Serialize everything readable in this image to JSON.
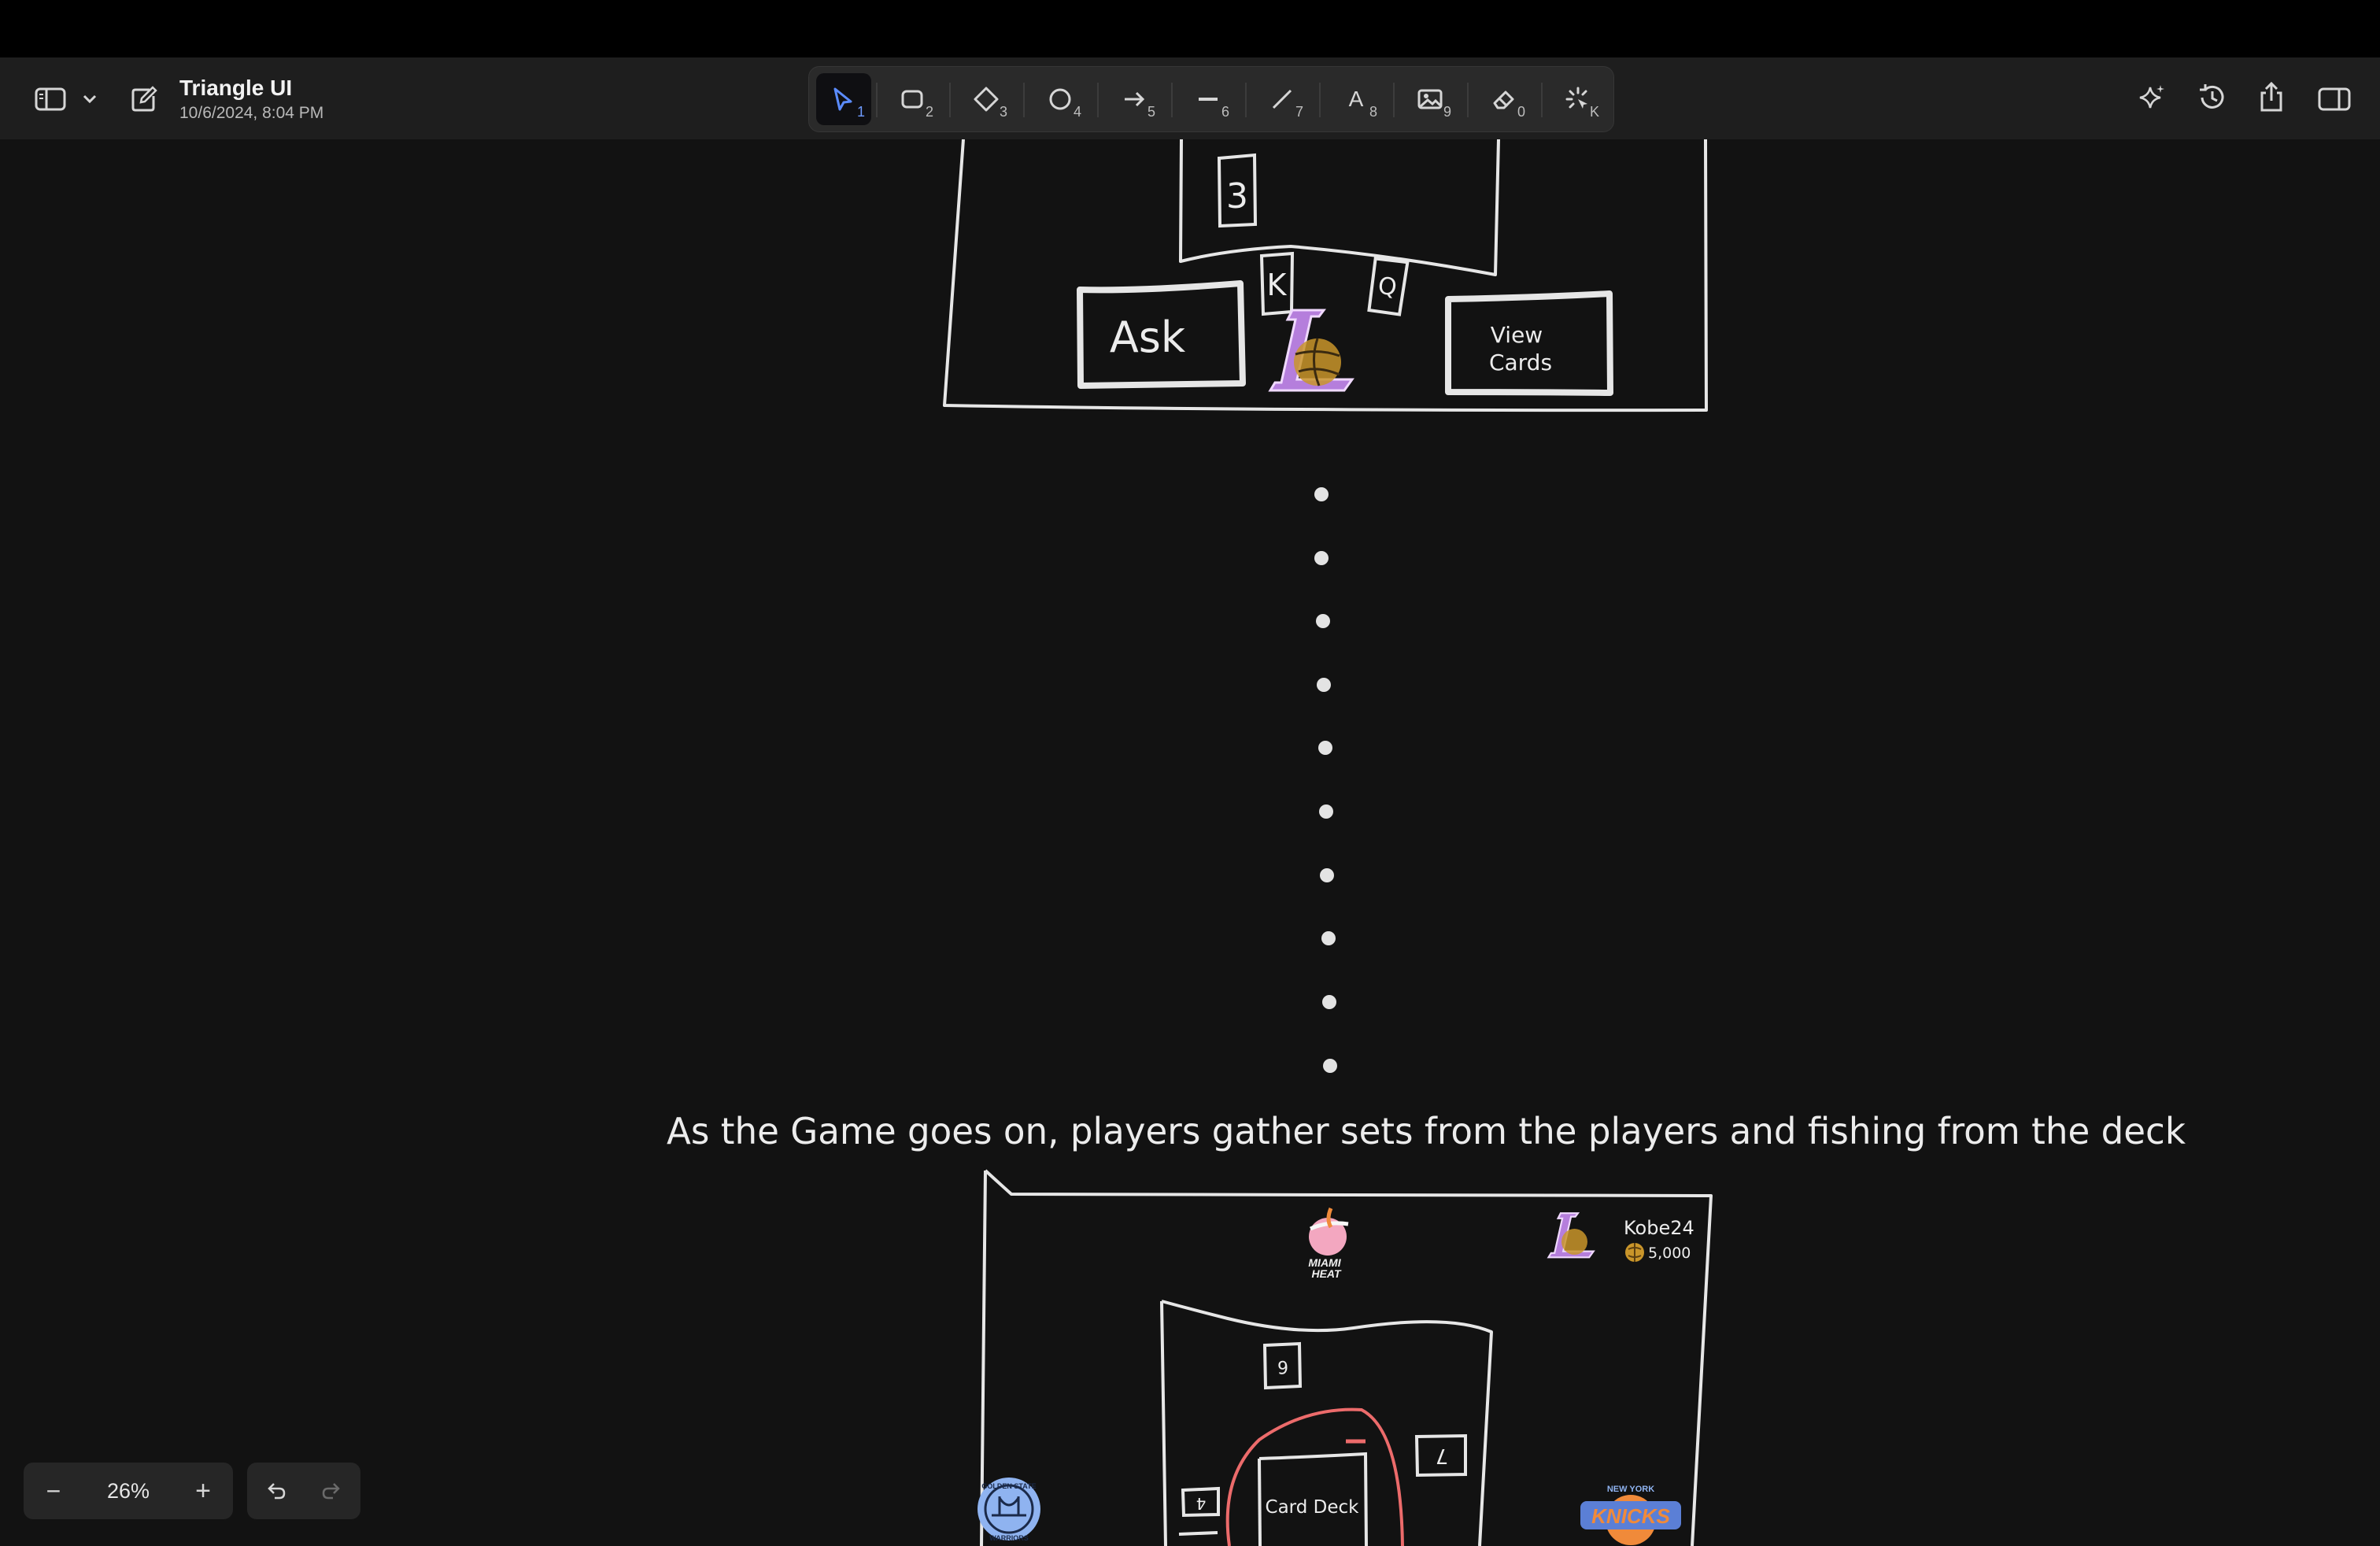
{
  "document": {
    "title": "Triangle UI",
    "date": "10/6/2024, 8:04 PM"
  },
  "tools": [
    {
      "name": "selection",
      "key": "1",
      "active": true
    },
    {
      "name": "rectangle",
      "key": "2"
    },
    {
      "name": "diamond",
      "key": "3"
    },
    {
      "name": "ellipse",
      "key": "4"
    },
    {
      "name": "arrow",
      "key": "5"
    },
    {
      "name": "line",
      "key": "6"
    },
    {
      "name": "draw",
      "key": "7"
    },
    {
      "name": "text",
      "key": "8",
      "glyph": "A"
    },
    {
      "name": "image",
      "key": "9"
    },
    {
      "name": "eraser",
      "key": "0"
    },
    {
      "name": "laser",
      "key": "K"
    }
  ],
  "zoom": {
    "value": "26%",
    "minus": "−",
    "plus": "+"
  },
  "canvas": {
    "top_scene": {
      "card_top": "3",
      "card_k": "K",
      "card_q": "Q",
      "ask_button": "Ask",
      "view_cards_line1": "View",
      "view_cards_line2": "Cards"
    },
    "caption": "As the Game goes on, players gather sets from the players and fishing from the deck",
    "bottom_scene": {
      "player_name": "Kobe24",
      "player_coins": "5,000",
      "card_deck": "Card Deck",
      "heat_line1": "MIAMI",
      "heat_line2": "HEAT",
      "warriors_text": "GOLDEN STATE",
      "warriors_bottom": "WARRIORS",
      "knicks_top": "NEW YORK",
      "knicks_text": "KNICKS",
      "card_six": "6",
      "card_seven": "7",
      "card_four": "4"
    }
  },
  "colors": {
    "lakers_purple": "#b57edc",
    "lakers_gold": "#c9952a",
    "heat_pink": "#f3a7c0",
    "deck_circle": "#ec6b6b",
    "warriors_blue": "#8fb3f0",
    "knicks_orange": "#f08a3a",
    "active_tool": "#5b8cff"
  }
}
